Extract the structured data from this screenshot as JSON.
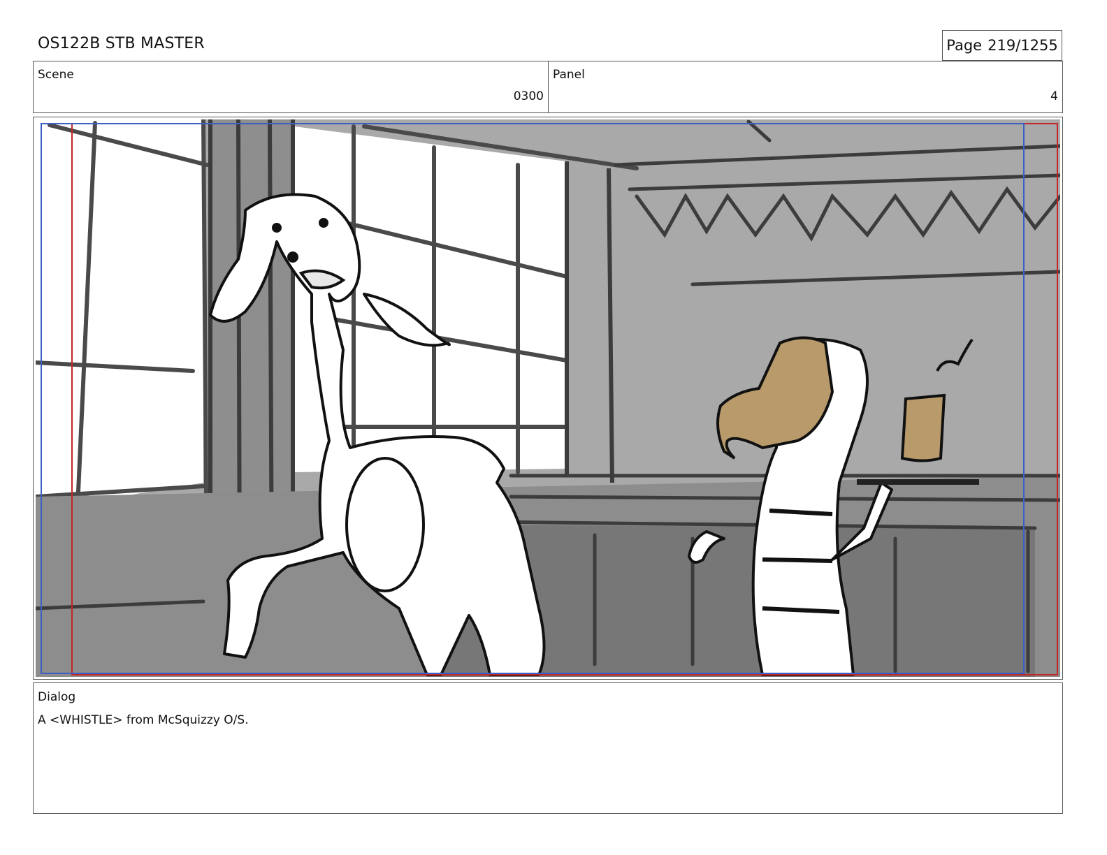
{
  "header": {
    "title": "OS122B STB MASTER",
    "page_label": "Page",
    "page_number": "219/1255"
  },
  "info": {
    "scene_label": "Scene",
    "scene_value": "0300",
    "panel_label": "Panel",
    "panel_value": "4"
  },
  "dialog": {
    "label": "Dialog",
    "text": "A <WHISTLE> from McSquizzy O/S."
  },
  "colors": {
    "safe_frame_red": "#c0262a",
    "action_frame_blue": "#3b5fc4",
    "sketch_gray_light": "#aaaaaa",
    "sketch_gray_dark": "#808080",
    "accent_tan": "#b99b6b"
  }
}
